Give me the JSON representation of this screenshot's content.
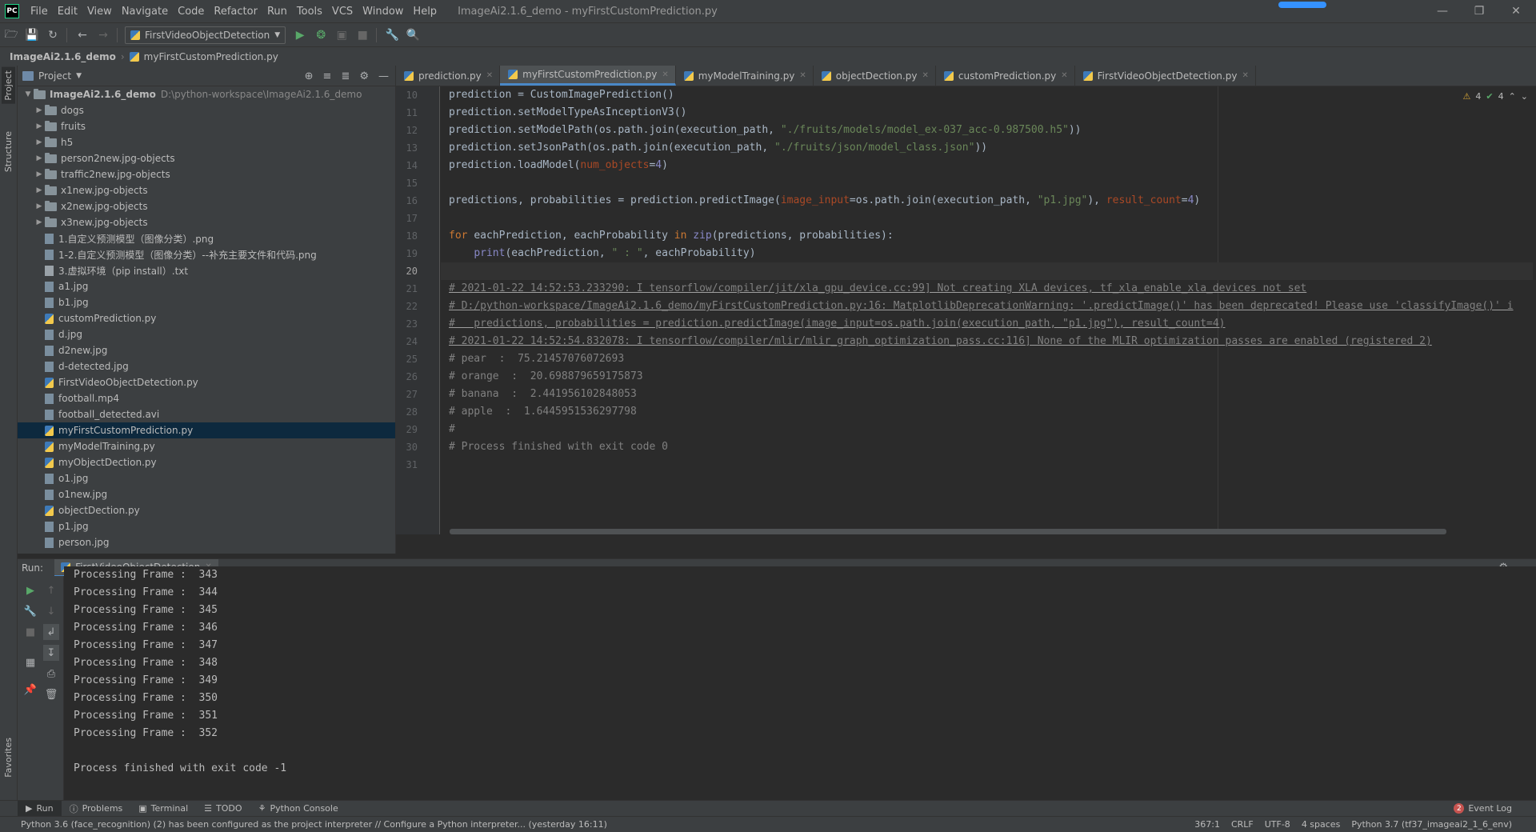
{
  "window": {
    "title": "ImageAi2.1.6_demo - myFirstCustomPrediction.py",
    "menu": [
      "File",
      "Edit",
      "View",
      "Navigate",
      "Code",
      "Refactor",
      "Run",
      "Tools",
      "VCS",
      "Window",
      "Help"
    ],
    "logo": "PC"
  },
  "toolbar": {
    "run_config": "FirstVideoObjectDetection"
  },
  "breadcrumb": {
    "project": "ImageAi2.1.6_demo",
    "file": "myFirstCustomPrediction.py"
  },
  "project_panel": {
    "title": "Project",
    "root_name": "ImageAi2.1.6_demo",
    "root_path": "D:\\python-workspace\\ImageAi2.1.6_demo",
    "items": [
      {
        "name": "dogs",
        "type": "folder"
      },
      {
        "name": "fruits",
        "type": "folder"
      },
      {
        "name": "h5",
        "type": "folder"
      },
      {
        "name": "person2new.jpg-objects",
        "type": "folder"
      },
      {
        "name": "traffic2new.jpg-objects",
        "type": "folder"
      },
      {
        "name": "x1new.jpg-objects",
        "type": "folder"
      },
      {
        "name": "x2new.jpg-objects",
        "type": "folder"
      },
      {
        "name": "x3new.jpg-objects",
        "type": "folder"
      },
      {
        "name": "1.自定义预测模型（图像分类）.png",
        "type": "img"
      },
      {
        "name": "1-2.自定义预测模型（图像分类）--补充主要文件和代码.png",
        "type": "img"
      },
      {
        "name": "3.虚拟环境（pip install）.txt",
        "type": "txt"
      },
      {
        "name": "a1.jpg",
        "type": "img"
      },
      {
        "name": "b1.jpg",
        "type": "img"
      },
      {
        "name": "customPrediction.py",
        "type": "py"
      },
      {
        "name": "d.jpg",
        "type": "img"
      },
      {
        "name": "d2new.jpg",
        "type": "img"
      },
      {
        "name": "d-detected.jpg",
        "type": "img"
      },
      {
        "name": "FirstVideoObjectDetection.py",
        "type": "py"
      },
      {
        "name": "football.mp4",
        "type": "img"
      },
      {
        "name": "football_detected.avi",
        "type": "img"
      },
      {
        "name": "myFirstCustomPrediction.py",
        "type": "py",
        "selected": true
      },
      {
        "name": "myModelTraining.py",
        "type": "py"
      },
      {
        "name": "myObjectDection.py",
        "type": "py"
      },
      {
        "name": "o1.jpg",
        "type": "img"
      },
      {
        "name": "o1new.jpg",
        "type": "img"
      },
      {
        "name": "objectDection.py",
        "type": "py"
      },
      {
        "name": "p1.jpg",
        "type": "img"
      },
      {
        "name": "person.jpg",
        "type": "img"
      }
    ]
  },
  "editor_tabs": [
    {
      "label": "prediction.py",
      "active": false
    },
    {
      "label": "myFirstCustomPrediction.py",
      "active": true
    },
    {
      "label": "myModelTraining.py",
      "active": false
    },
    {
      "label": "objectDection.py",
      "active": false
    },
    {
      "label": "customPrediction.py",
      "active": false
    },
    {
      "label": "FirstVideoObjectDetection.py",
      "active": false
    }
  ],
  "inspection": {
    "warnings": "4",
    "ok": "4"
  },
  "code": {
    "line_numbers": [
      "10",
      "11",
      "12",
      "13",
      "14",
      "15",
      "16",
      "17",
      "18",
      "19",
      "20",
      "21",
      "22",
      "23",
      "24",
      "25",
      "26",
      "27",
      "28",
      "29",
      "30",
      "31"
    ],
    "current_line": "20",
    "lines": [
      {
        "style": "plain",
        "parts": [
          [
            "",
            "prediction = CustomImagePrediction()"
          ]
        ]
      },
      {
        "style": "plain",
        "parts": [
          [
            "",
            "prediction.setModelTypeAsInceptionV3()"
          ]
        ]
      },
      {
        "style": "plain",
        "parts": [
          [
            "",
            "prediction.setModelPath(os.path.join(execution_path, "
          ],
          [
            "str",
            "\"./fruits/models/model_ex-037_acc-0.987500.h5\""
          ],
          [
            "",
            "))"
          ]
        ]
      },
      {
        "style": "plain",
        "parts": [
          [
            "",
            "prediction.setJsonPath(os.path.join(execution_path, "
          ],
          [
            "str",
            "\"./fruits/json/model_class.json\""
          ],
          [
            "",
            "))"
          ]
        ]
      },
      {
        "style": "plain",
        "parts": [
          [
            "",
            "prediction.loadModel("
          ],
          [
            "param",
            "num_objects"
          ],
          [
            "",
            "="
          ],
          [
            "bi",
            "4"
          ],
          [
            "",
            ")"
          ]
        ]
      },
      {
        "style": "plain",
        "parts": [
          [
            "",
            ""
          ]
        ]
      },
      {
        "style": "plain",
        "parts": [
          [
            "",
            "predictions, probabilities = prediction.predictImage("
          ],
          [
            "param",
            "image_input"
          ],
          [
            "",
            "=os.path.join(execution_path, "
          ],
          [
            "str",
            "\"p1.jpg\""
          ],
          [
            "",
            "), "
          ],
          [
            "param",
            "result_count"
          ],
          [
            "",
            "="
          ],
          [
            "bi",
            "4"
          ],
          [
            "",
            ")"
          ]
        ]
      },
      {
        "style": "plain",
        "parts": [
          [
            "",
            ""
          ]
        ]
      },
      {
        "style": "plain",
        "parts": [
          [
            "kw",
            "for "
          ],
          [
            "",
            "eachPrediction, eachProbability "
          ],
          [
            "kw",
            "in "
          ],
          [
            "bi",
            "zip"
          ],
          [
            "",
            "(predictions, probabilities):"
          ]
        ]
      },
      {
        "style": "plain",
        "parts": [
          [
            "",
            "    "
          ],
          [
            "bi",
            "print"
          ],
          [
            "",
            "(eachPrediction, "
          ],
          [
            "str",
            "\" : \""
          ],
          [
            "",
            ", eachProbability)"
          ]
        ]
      },
      {
        "style": "curline",
        "parts": [
          [
            "",
            ""
          ]
        ]
      },
      {
        "style": "cmt-u",
        "parts": [
          [
            "",
            "# 2021-01-22 14:52:53.233290: I tensorflow/compiler/jit/xla_gpu_device.cc:99] Not creating XLA devices, tf_xla_enable_xla_devices not set"
          ]
        ]
      },
      {
        "style": "cmt-u",
        "parts": [
          [
            "",
            "# D:/python-workspace/ImageAi2.1.6_demo/myFirstCustomPrediction.py:16: MatplotlibDeprecationWarning: '.predictImage()' has been deprecated! Please use 'classifyImage()' i"
          ]
        ]
      },
      {
        "style": "cmt-u",
        "parts": [
          [
            "",
            "#   predictions, probabilities = prediction.predictImage(image_input=os.path.join(execution_path, \"p1.jpg\"), result_count=4)"
          ]
        ]
      },
      {
        "style": "cmt-u",
        "parts": [
          [
            "",
            "# 2021-01-22 14:52:54.832078: I tensorflow/compiler/mlir/mlir_graph_optimization_pass.cc:116] None of the MLIR optimization passes are enabled (registered 2)"
          ]
        ]
      },
      {
        "style": "cmt",
        "parts": [
          [
            "",
            "# pear  :  75.21457076072693"
          ]
        ]
      },
      {
        "style": "cmt",
        "parts": [
          [
            "",
            "# orange  :  20.698879659175873"
          ]
        ]
      },
      {
        "style": "cmt",
        "parts": [
          [
            "",
            "# banana  :  2.441956102848053"
          ]
        ]
      },
      {
        "style": "cmt",
        "parts": [
          [
            "",
            "# apple  :  1.6445951536297798"
          ]
        ]
      },
      {
        "style": "cmt",
        "parts": [
          [
            "",
            "#"
          ]
        ]
      },
      {
        "style": "cmt",
        "parts": [
          [
            "",
            "# Process finished with exit code 0"
          ]
        ]
      },
      {
        "style": "plain",
        "parts": [
          [
            "",
            ""
          ]
        ]
      }
    ]
  },
  "run_panel": {
    "label": "Run:",
    "tab": "FirstVideoObjectDetection",
    "output": [
      "Processing Frame :  343",
      "Processing Frame :  344",
      "Processing Frame :  345",
      "Processing Frame :  346",
      "Processing Frame :  347",
      "Processing Frame :  348",
      "Processing Frame :  349",
      "Processing Frame :  350",
      "Processing Frame :  351",
      "Processing Frame :  352",
      "",
      "Process finished with exit code -1"
    ]
  },
  "side_tabs": {
    "project": "Project",
    "structure": "Structure",
    "favorites": "Favorites"
  },
  "bottom_tabs": [
    "Run",
    "Problems",
    "Terminal",
    "TODO",
    "Python Console"
  ],
  "event_log": {
    "label": "Event Log",
    "count": "2"
  },
  "status": {
    "message": "Python 3.6 (face_recognition) (2) has been configured as the project interpreter // Configure a Python interpreter... (yesterday 16:11)",
    "position": "367:1",
    "line_sep": "CRLF",
    "encoding": "UTF-8",
    "indent": "4 spaces",
    "interpreter": "Python 3.7 (tf37_imageai2_1_6_env)"
  }
}
